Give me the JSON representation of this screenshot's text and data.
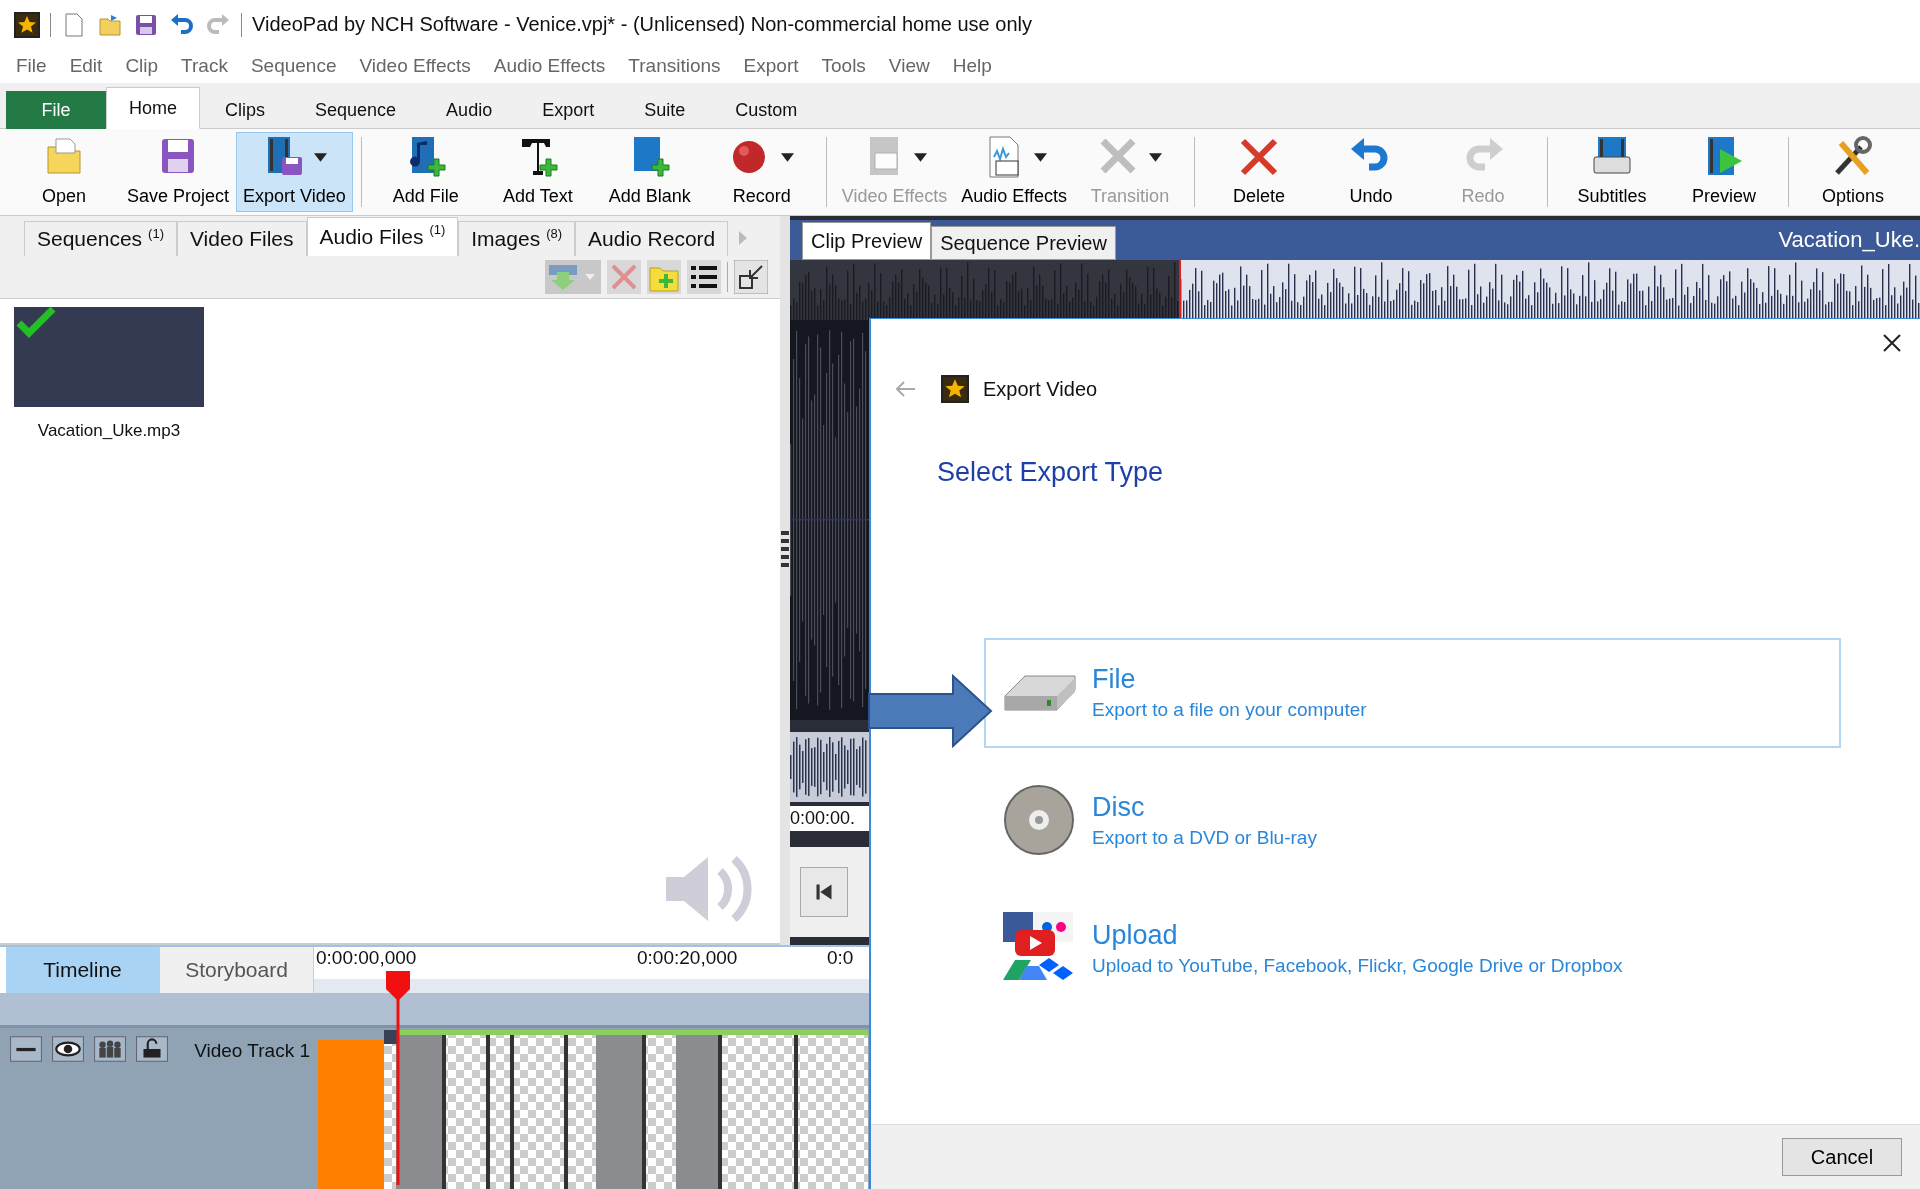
{
  "window": {
    "title": "VideoPad by NCH Software - Venice.vpj* - (Unlicensed) Non-commercial home use only"
  },
  "menu": [
    "File",
    "Edit",
    "Clip",
    "Track",
    "Sequence",
    "Video Effects",
    "Audio Effects",
    "Transitions",
    "Export",
    "Tools",
    "View",
    "Help"
  ],
  "ribbon_tabs": [
    {
      "label": "File",
      "kind": "file",
      "selected": false
    },
    {
      "label": "Home",
      "kind": "tab",
      "selected": true
    },
    {
      "label": "Clips",
      "kind": "tab",
      "selected": false
    },
    {
      "label": "Sequence",
      "kind": "tab",
      "selected": false
    },
    {
      "label": "Audio",
      "kind": "tab",
      "selected": false
    },
    {
      "label": "Export",
      "kind": "tab",
      "selected": false
    },
    {
      "label": "Suite",
      "kind": "tab",
      "selected": false
    },
    {
      "label": "Custom",
      "kind": "tab",
      "selected": false
    }
  ],
  "toolbar_groups": [
    {
      "items": [
        {
          "label": "Open",
          "kind": "open",
          "selected": false,
          "disabled": false,
          "dropdown": false
        },
        {
          "label": "Save Project",
          "kind": "save",
          "selected": false,
          "disabled": false,
          "dropdown": false
        },
        {
          "label": "Export Video",
          "kind": "export",
          "selected": true,
          "disabled": false,
          "dropdown": true
        }
      ]
    },
    {
      "items": [
        {
          "label": "Add File",
          "kind": "add-file",
          "selected": false,
          "disabled": false,
          "dropdown": false
        },
        {
          "label": "Add Text",
          "kind": "add-text",
          "selected": false,
          "disabled": false,
          "dropdown": false
        },
        {
          "label": "Add Blank",
          "kind": "add-blank",
          "selected": false,
          "disabled": false,
          "dropdown": false
        },
        {
          "label": "Record",
          "kind": "record",
          "selected": false,
          "disabled": false,
          "dropdown": true
        }
      ]
    },
    {
      "items": [
        {
          "label": "Video Effects",
          "kind": "video-fx",
          "selected": false,
          "disabled": true,
          "dropdown": true
        },
        {
          "label": "Audio Effects",
          "kind": "audio-fx",
          "selected": false,
          "disabled": false,
          "dropdown": true
        },
        {
          "label": "Transition",
          "kind": "transition",
          "selected": false,
          "disabled": true,
          "dropdown": true
        }
      ]
    },
    {
      "items": [
        {
          "label": "Delete",
          "kind": "delete",
          "selected": false,
          "disabled": false,
          "dropdown": false
        },
        {
          "label": "Undo",
          "kind": "undo",
          "selected": false,
          "disabled": false,
          "dropdown": false
        },
        {
          "label": "Redo",
          "kind": "redo",
          "selected": false,
          "disabled": true,
          "dropdown": false
        }
      ]
    },
    {
      "items": [
        {
          "label": "Subtitles",
          "kind": "subtitles",
          "selected": false,
          "disabled": false,
          "dropdown": false
        },
        {
          "label": "Preview",
          "kind": "preview",
          "selected": false,
          "disabled": false,
          "dropdown": false
        }
      ]
    },
    {
      "items": [
        {
          "label": "Options",
          "kind": "options",
          "selected": false,
          "disabled": false,
          "dropdown": false
        }
      ]
    }
  ],
  "bin_tabs": [
    {
      "label": "Sequences",
      "count": "(1)",
      "selected": false
    },
    {
      "label": "Video Files",
      "selected": false
    },
    {
      "label": "Audio Files",
      "count": "(1)",
      "selected": true
    },
    {
      "label": "Images",
      "count": "(8)",
      "selected": false
    },
    {
      "label": "Audio Record",
      "selected": false
    }
  ],
  "bin_items": [
    {
      "name": "Vacation_Uke.mp3",
      "checked": true
    }
  ],
  "preview": {
    "tabs": [
      {
        "label": "Clip Preview",
        "selected": true
      },
      {
        "label": "Sequence Preview",
        "selected": false
      }
    ],
    "clip_name": "Vacation_Uke.",
    "time": "0:00:00."
  },
  "timeline": {
    "tabs": [
      {
        "label": "Timeline",
        "selected": true
      },
      {
        "label": "Storyboard",
        "selected": false
      }
    ],
    "ruler": [
      "0:00:00,000",
      "0:00:20,000",
      "0:0"
    ],
    "tracks": [
      {
        "name": "Video Track 1"
      }
    ]
  },
  "dialog": {
    "title": "Export Video",
    "heading": "Select Export Type",
    "options": [
      {
        "kind": "file",
        "title": "File",
        "description": "Export to a file on your computer",
        "selected": true
      },
      {
        "kind": "disc",
        "title": "Disc",
        "description": "Export to a DVD or Blu-ray",
        "selected": false
      },
      {
        "kind": "upload",
        "title": "Upload",
        "description": "Upload to YouTube, Facebook, Flickr, Google Drive or Dropbox",
        "selected": false
      }
    ],
    "buttons": [
      "Cancel"
    ]
  }
}
